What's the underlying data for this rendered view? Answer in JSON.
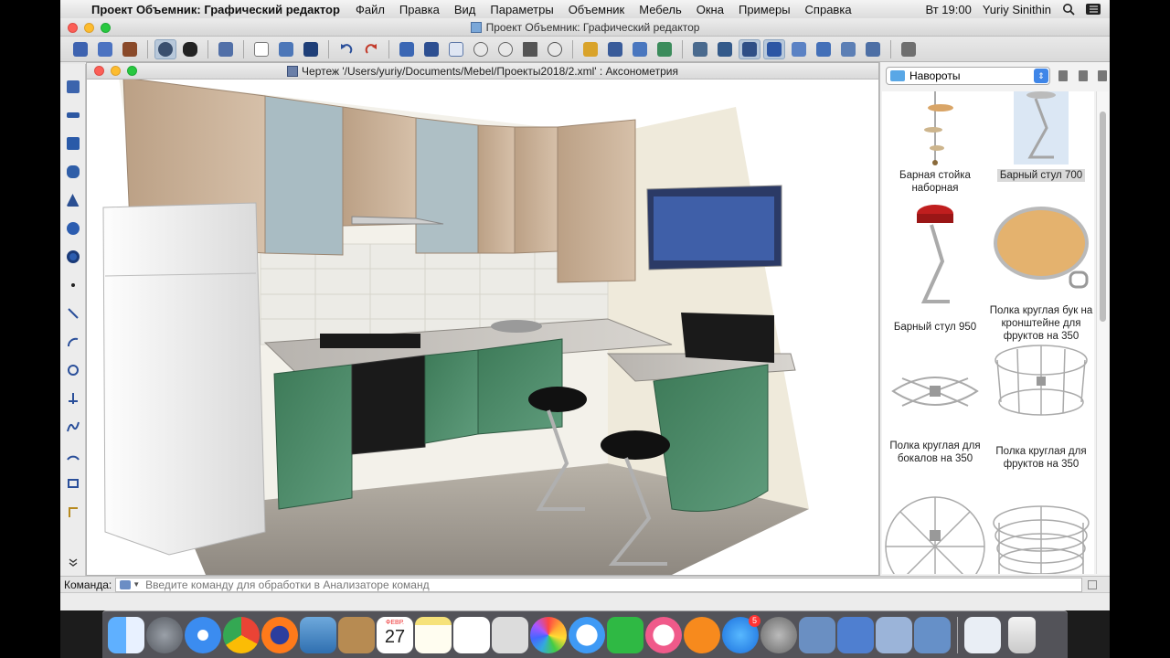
{
  "menubar": {
    "app_name": "Проект Объемник: Графический редактор",
    "items": [
      "Файл",
      "Правка",
      "Вид",
      "Параметры",
      "Объемник",
      "Мебель",
      "Окна",
      "Примеры",
      "Справка"
    ],
    "clock": "Вт 19:00",
    "user": "Yuriy Sinithin"
  },
  "window": {
    "title": "Проект Объемник: Графический редактор"
  },
  "drawing": {
    "title": "Чертеж '/Users/yuriy/Documents/Mebel/Проекты2018/2.xml' : Аксонометрия"
  },
  "library": {
    "category": "Навороты",
    "items": [
      {
        "label": "Барная стойка наборная",
        "selected": false
      },
      {
        "label": "Барный стул 700",
        "selected": true
      },
      {
        "label": "Барный стул 950",
        "selected": false
      },
      {
        "label": "Полка круглая бук на кронштейне для фруктов на 350",
        "selected": false
      },
      {
        "label": "Полка круглая для бокалов на 350",
        "selected": false
      },
      {
        "label": "Полка круглая для фруктов на 350",
        "selected": false
      },
      {
        "label": "",
        "selected": false
      },
      {
        "label": "",
        "selected": false
      }
    ]
  },
  "command": {
    "label": "Команда:",
    "placeholder": "Введите команду для обработки в Анализаторе команд"
  },
  "dock": {
    "calendar_month": "ФЕВР.",
    "calendar_day": "27",
    "appstore_badge": "5",
    "apps": [
      "finder",
      "launchpad",
      "safari",
      "chrome",
      "firefox",
      "preview-photo",
      "contacts",
      "calendar",
      "notes",
      "reminders",
      "photo-slideshow",
      "photos",
      "messages",
      "facetime",
      "itunes",
      "ibooks",
      "app-store",
      "system-preferences",
      "image-capture",
      "keynote",
      "archive-utility",
      "xcode-tool",
      "downloads",
      "trash"
    ]
  },
  "colors": {
    "accent": "#3f86e8",
    "cabinet_green": "#4f8c6b",
    "cabinet_top": "#c9b39c",
    "wall": "#f1eee6"
  }
}
